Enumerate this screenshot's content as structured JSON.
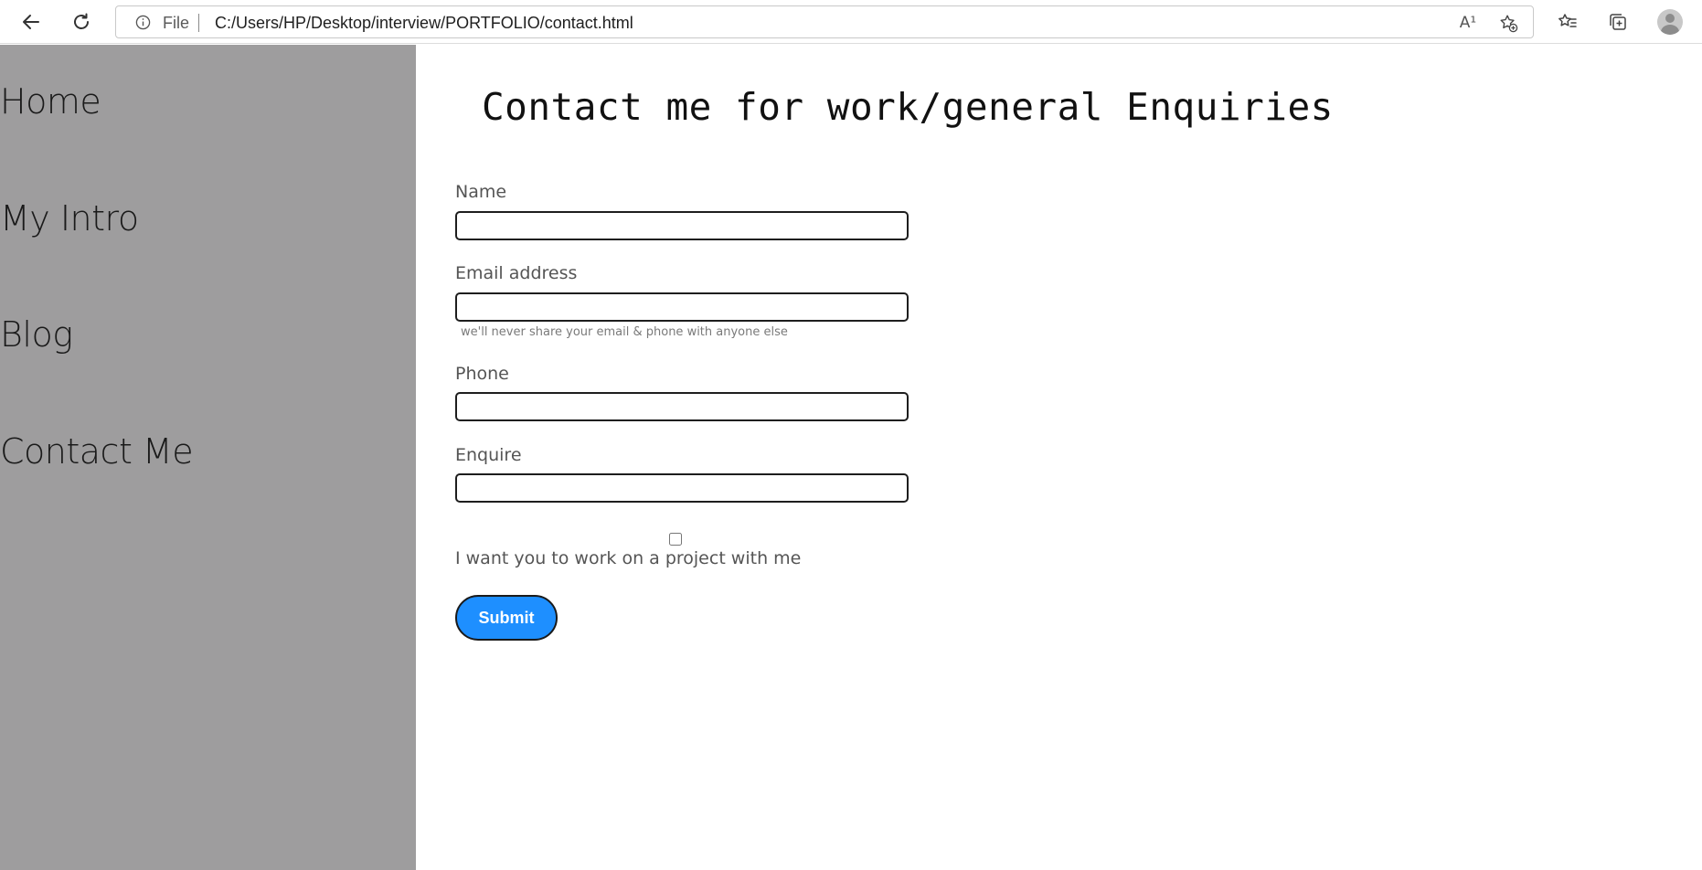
{
  "browser": {
    "scheme_label": "File",
    "url": "C:/Users/HP/Desktop/interview/PORTFOLIO/contact.html",
    "read_aloud_glyph": "A¹",
    "icons": [
      "back-arrow-icon",
      "refresh-icon",
      "info-icon",
      "read-aloud-icon",
      "add-favorite-icon",
      "favorites-icon",
      "collections-icon",
      "profile-avatar-icon"
    ]
  },
  "sidebar": {
    "background": "#9e9d9e",
    "items": [
      {
        "label": "Home"
      },
      {
        "label": "My Intro"
      },
      {
        "label": "Blog"
      },
      {
        "label": "Contact Me"
      }
    ]
  },
  "page": {
    "title": "Contact me for work/general Enquiries"
  },
  "form": {
    "name_label": "Name",
    "name_value": "",
    "email_label": "Email address",
    "email_value": "",
    "email_help": "we'll never share your email & phone with anyone else",
    "phone_label": "Phone",
    "phone_value": "",
    "enquire_label": "Enquire",
    "enquire_value": "",
    "project_checkbox_checked": false,
    "project_checkbox_label": "I want you to work on a project with me",
    "submit_label": "Submit",
    "submit_color": "#1e8fff"
  }
}
